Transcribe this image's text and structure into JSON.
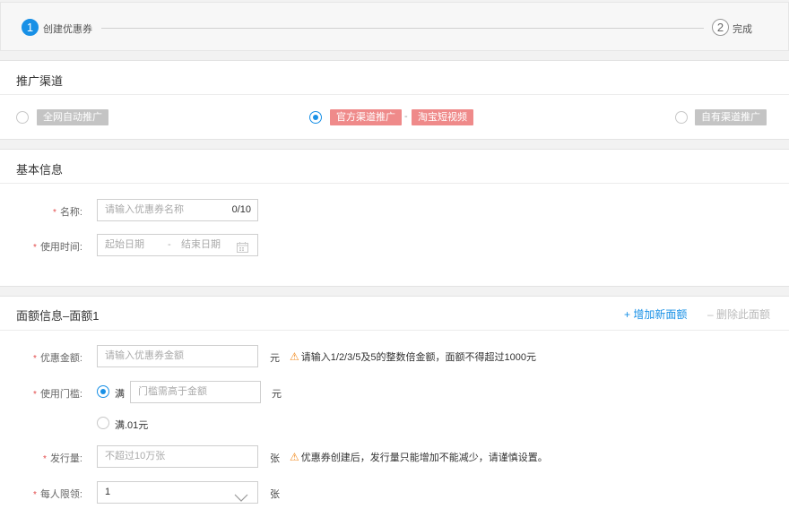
{
  "steps": {
    "step1": {
      "number": "1",
      "label": "创建优惠券"
    },
    "step2": {
      "number": "2",
      "label": "完成"
    }
  },
  "channel": {
    "title": "推广渠道",
    "options": [
      {
        "label": "全网自动推广",
        "selected": false
      },
      {
        "label": "官方渠道推广",
        "sub_label": "淘宝短视频",
        "selected": true
      },
      {
        "label": "自有渠道推广",
        "selected": false
      }
    ],
    "separator": "-"
  },
  "basic": {
    "title": "基本信息",
    "name": {
      "label": "名称:",
      "placeholder": "请输入优惠券名称",
      "counter": "0/10"
    },
    "time": {
      "label": "使用时间:",
      "start_placeholder": "起始日期",
      "separator": "-",
      "end_placeholder": "结束日期"
    }
  },
  "denom": {
    "title": "面额信息–面额1",
    "add_label": "+ 增加新面额",
    "delete_label": "– 删除此面额",
    "amount": {
      "label": "优惠金额:",
      "placeholder": "请输入优惠券金额",
      "unit": "元",
      "warning": "请输入1/2/3/5及5的整数倍金额，面额不得超过1000元"
    },
    "threshold": {
      "label": "使用门槛:",
      "option1_label": "满",
      "placeholder": "门槛需高于金额",
      "unit": "元",
      "option2_label": "满.01元"
    },
    "issue": {
      "label": "发行量:",
      "placeholder": "不超过10万张",
      "unit": "张",
      "warning": "优惠券创建后，发行量只能增加不能减少，请谨慎设置。"
    },
    "limit": {
      "label": "每人限领:",
      "value": "1",
      "unit": "张"
    }
  },
  "colors": {
    "accent": "#1890e6",
    "required": "#e34d4d",
    "warning": "#f28b20",
    "tag_grey": "#c4c4c4",
    "tag_pink": "#ef8a8a"
  }
}
